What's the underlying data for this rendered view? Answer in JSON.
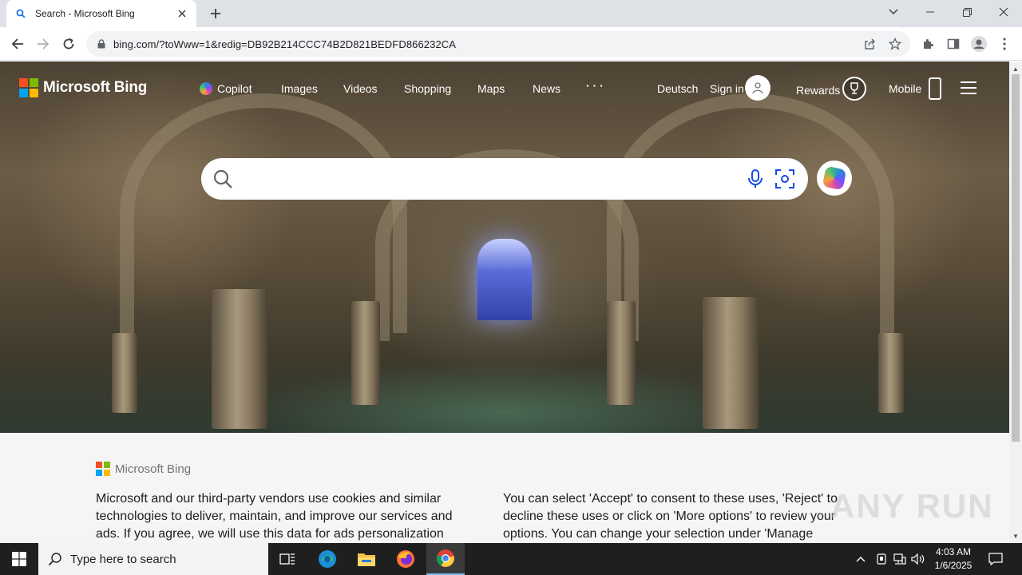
{
  "browser": {
    "tab_title": "Search - Microsoft Bing",
    "url": "bing.com/?toWww=1&redig=DB92B214CCC74B2D821BEDFD866232CA"
  },
  "bing": {
    "logo_text": "Microsoft Bing",
    "nav": {
      "copilot": "Copilot",
      "images": "Images",
      "videos": "Videos",
      "shopping": "Shopping",
      "maps": "Maps",
      "news": "News",
      "more": "· · ·"
    },
    "language": "Deutsch",
    "sign_in": "Sign in",
    "rewards": "Rewards",
    "mobile": "Mobile",
    "search": {
      "value": "",
      "placeholder": ""
    }
  },
  "consent": {
    "logo_text": "Microsoft Bing",
    "left_text": "Microsoft and our third-party vendors use cookies and similar technologies to deliver, maintain, and improve our services and ads. If you agree, we will use this data for ads personalization and",
    "right_text": "You can select 'Accept' to consent to these uses, 'Reject' to decline these uses or click on 'More options' to review your options. You can change your selection under 'Manage Cookie"
  },
  "watermark": "ANY RUN",
  "taskbar": {
    "search_placeholder": "Type here to search",
    "time": "4:03 AM",
    "date": "1/6/2025"
  },
  "colors": {
    "logo_red": "#f25022",
    "logo_green": "#7fba00",
    "logo_blue": "#00a4ef",
    "logo_yellow": "#ffb900",
    "chrome_tabstrip": "#dee1e6",
    "taskbar": "#1f1f1f"
  }
}
